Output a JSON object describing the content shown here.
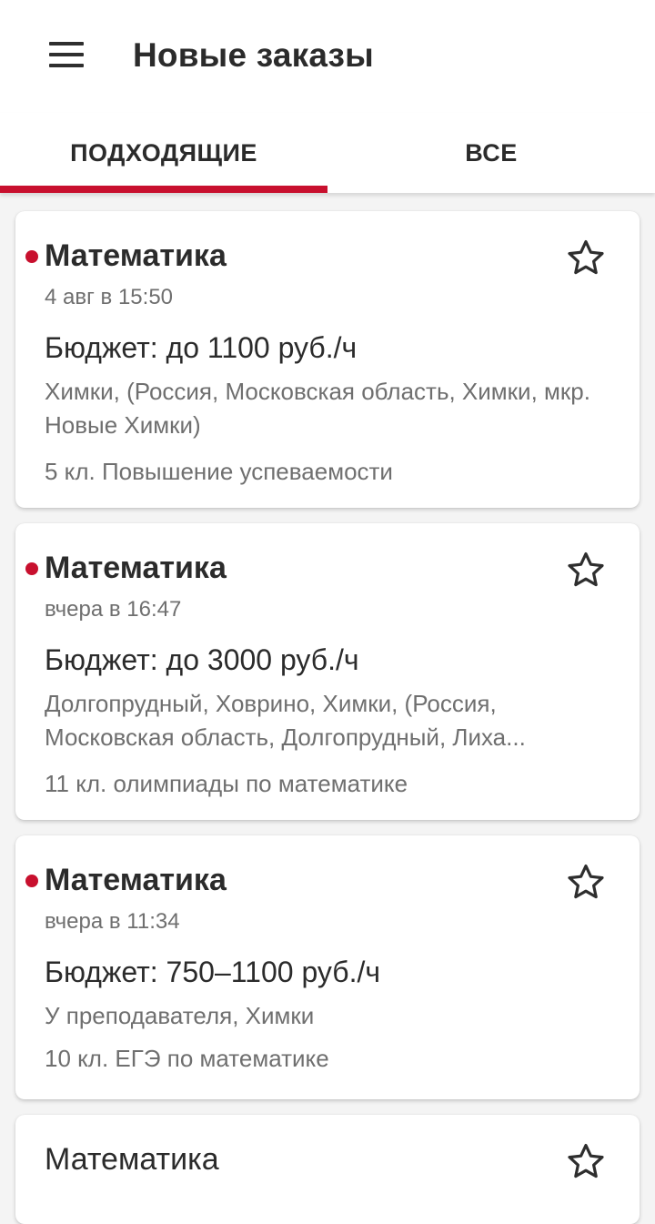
{
  "appbar": {
    "title": "Новые заказы",
    "menu_icon": "hamburger-menu-icon"
  },
  "tabs": [
    {
      "label": "ПОДХОДЯЩИЕ",
      "active": true
    },
    {
      "label": "ВСЕ",
      "active": false
    }
  ],
  "colors": {
    "accent": "#c8102e",
    "text_primary": "#2b2b2b",
    "text_secondary": "#6f6f6f",
    "background": "#f4f4f4"
  },
  "orders": [
    {
      "subject": "Математика",
      "new": true,
      "date": "4 авг в 15:50",
      "budget": "Бюджет: до 1100 руб./ч",
      "location": "Химки, (Россия, Московская область, Химки, мкр. Новые Химки)",
      "grade": "5 кл. Повышение успеваемости",
      "favorite_icon": "star-outline-icon"
    },
    {
      "subject": "Математика",
      "new": true,
      "date": "вчера в 16:47",
      "budget": "Бюджет: до 3000 руб./ч",
      "location": "Долгопрудный, Ховрино, Химки, (Россия, Московская область, Долгопрудный, Лиха...",
      "grade": "11 кл. олимпиады по математике",
      "favorite_icon": "star-outline-icon"
    },
    {
      "subject": "Математика",
      "new": true,
      "date": "вчера в 11:34",
      "budget": "Бюджет: 750–1100 руб./ч",
      "location": "У преподавателя, Химки",
      "grade": "10 кл. ЕГЭ по математике",
      "favorite_icon": "star-outline-icon"
    },
    {
      "subject": "Математика",
      "new": false,
      "favorite_icon": "star-outline-icon"
    }
  ]
}
